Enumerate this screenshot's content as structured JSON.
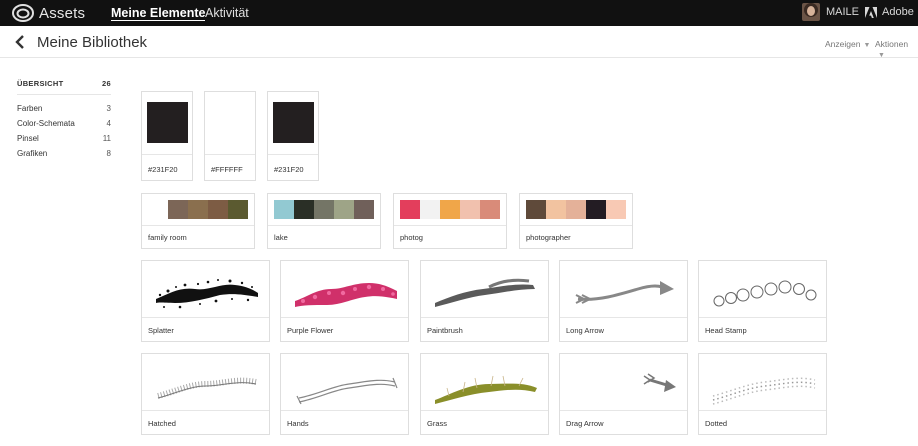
{
  "topbar": {
    "brand": "Assets",
    "nav": [
      "Meine Elemente",
      "Aktivität"
    ],
    "user": "MAILE",
    "company": "Adobe"
  },
  "header": {
    "title": "Meine Bibliothek",
    "menu_view": "Anzeigen",
    "menu_actions": "Aktionen"
  },
  "sidebar": {
    "overview_label": "ÜBERSICHT",
    "overview_count": "26",
    "items": [
      {
        "label": "Farben",
        "count": "3"
      },
      {
        "label": "Color-Schemata",
        "count": "4"
      },
      {
        "label": "Pinsel",
        "count": "11"
      },
      {
        "label": "Grafiken",
        "count": "8"
      }
    ]
  },
  "colors": [
    {
      "label": "#231F20",
      "hex": "#231F20"
    },
    {
      "label": "#FFFFFF",
      "hex": "#FFFFFF"
    },
    {
      "label": "#231F20",
      "hex": "#231F20"
    }
  ],
  "themes": [
    {
      "label": "family room",
      "swatches": [
        "#7c6657",
        "#8a6f4e",
        "#7d5c44",
        "#5b5a30"
      ]
    },
    {
      "label": "lake",
      "swatches": [
        "#92c9d2",
        "#2a2f26",
        "#747566",
        "#9ea487",
        "#70605a"
      ]
    },
    {
      "label": "photog",
      "swatches": [
        "#e33e5c",
        "#f2f2f2",
        "#f0a649",
        "#f1c1ae",
        "#d98b79"
      ]
    },
    {
      "label": "photographer",
      "swatches": [
        "#5f4a3a",
        "#f2c3a0",
        "#e4b199",
        "#231c23",
        "#f8c9b4"
      ]
    }
  ],
  "brushes": [
    {
      "label": "Splatter",
      "icon": "splatter-brush-icon"
    },
    {
      "label": "Purple Flower",
      "icon": "purple-flower-brush-icon"
    },
    {
      "label": "Paintbrush",
      "icon": "paintbrush-brush-icon"
    },
    {
      "label": "Long Arrow",
      "icon": "long-arrow-brush-icon"
    },
    {
      "label": "Head Stamp",
      "icon": "head-stamp-brush-icon"
    },
    {
      "label": "Hatched",
      "icon": "hatched-brush-icon"
    },
    {
      "label": "Hands",
      "icon": "hands-brush-icon"
    },
    {
      "label": "Grass",
      "icon": "grass-brush-icon"
    },
    {
      "label": "Drag Arrow",
      "icon": "drag-arrow-brush-icon"
    },
    {
      "label": "Dotted",
      "icon": "dotted-brush-icon"
    }
  ]
}
